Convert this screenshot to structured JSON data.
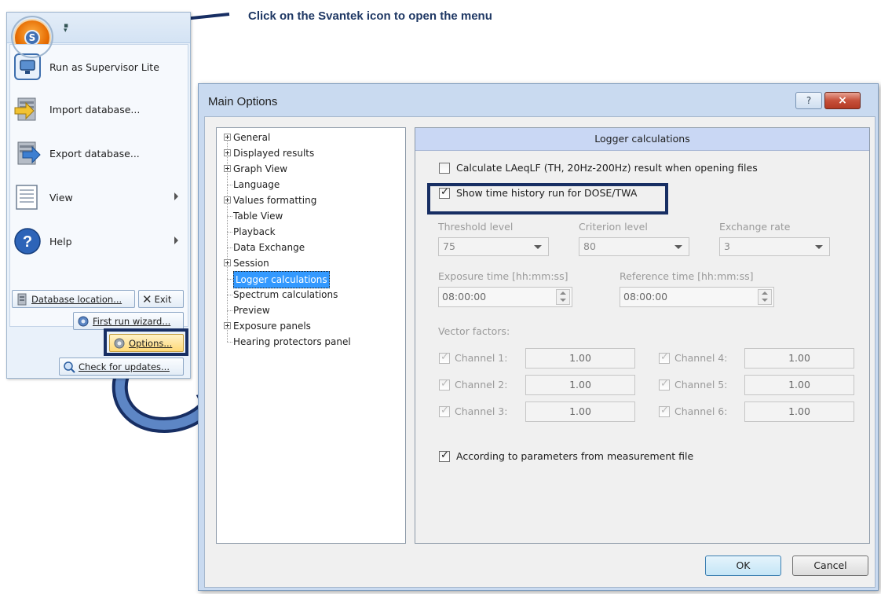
{
  "instruction": "Click on the Svantek icon to open the menu",
  "app_menu": {
    "items": [
      {
        "label": "Run as Supervisor Lite",
        "icon": "monitor-icon"
      },
      {
        "label": "Import database...",
        "icon": "import-database-icon"
      },
      {
        "label": "Export database...",
        "icon": "export-database-icon"
      },
      {
        "label": "View",
        "icon": "view-icon"
      },
      {
        "label": "Help",
        "icon": "help-icon"
      }
    ],
    "database_location": "Database location...",
    "exit": "Exit",
    "first_run_wizard": "First run wizard...",
    "options": "Options...",
    "check_for_updates": "Check for updates..."
  },
  "dialog": {
    "title": "Main Options",
    "help": "?",
    "close": "×",
    "tree": [
      {
        "label": "General",
        "expandable": true
      },
      {
        "label": "Displayed results",
        "expandable": true
      },
      {
        "label": "Graph View",
        "expandable": true
      },
      {
        "label": "Language",
        "expandable": false
      },
      {
        "label": "Values formatting",
        "expandable": true
      },
      {
        "label": "Table View",
        "expandable": false
      },
      {
        "label": "Playback",
        "expandable": false
      },
      {
        "label": "Data Exchange",
        "expandable": false
      },
      {
        "label": "Session",
        "expandable": true
      },
      {
        "label": "Logger calculations",
        "expandable": false,
        "selected": true
      },
      {
        "label": "Spectrum calculations",
        "expandable": false
      },
      {
        "label": "Preview",
        "expandable": false
      },
      {
        "label": "Exposure panels",
        "expandable": true
      },
      {
        "label": "Hearing protectors panel",
        "expandable": false
      }
    ],
    "panel_title": "Logger calculations",
    "calc_laeq": {
      "label": "Calculate LAeqLF (TH, 20Hz-200Hz) result when opening files",
      "checked": false
    },
    "show_history": {
      "label": "Show time history run for DOSE/TWA",
      "checked": true
    },
    "threshold": {
      "label": "Threshold level",
      "value": "75"
    },
    "criterion": {
      "label": "Criterion level",
      "value": "80"
    },
    "exchange": {
      "label": "Exchange rate",
      "value": "3"
    },
    "exposure_time": {
      "label": "Exposure time [hh:mm:ss]",
      "value": "08:00:00"
    },
    "reference_time": {
      "label": "Reference time [hh:mm:ss]",
      "value": "08:00:00"
    },
    "vector_factors_label": "Vector factors:",
    "channels": [
      {
        "label": "Channel 1:",
        "value": "1.00"
      },
      {
        "label": "Channel 2:",
        "value": "1.00"
      },
      {
        "label": "Channel 3:",
        "value": "1.00"
      },
      {
        "label": "Channel 4:",
        "value": "1.00"
      },
      {
        "label": "Channel 5:",
        "value": "1.00"
      },
      {
        "label": "Channel 6:",
        "value": "1.00"
      }
    ],
    "according": {
      "label": "According to parameters from measurement file",
      "checked": true
    },
    "ok": "OK",
    "cancel": "Cancel"
  },
  "colors": {
    "annotation": "#172e63",
    "selection": "#3399ff",
    "header": "#c9d7f4",
    "svantek_orange": "#e56a00"
  }
}
